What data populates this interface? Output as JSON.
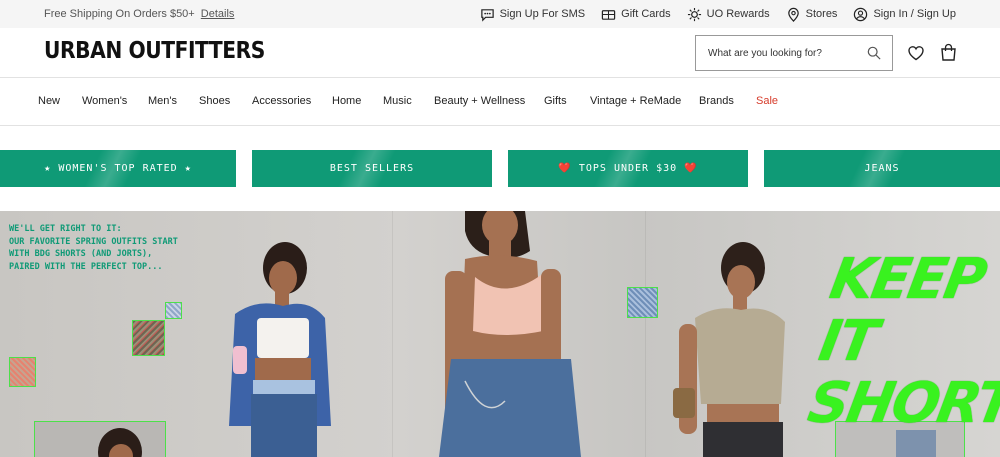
{
  "utility_bar": {
    "promo_text": "Free Shipping On Orders $50+",
    "promo_link": "Details",
    "links": [
      {
        "label": "Sign Up For SMS",
        "icon": "chat-icon"
      },
      {
        "label": "Gift Cards",
        "icon": "gift-card-icon"
      },
      {
        "label": "UO Rewards",
        "icon": "rewards-icon"
      },
      {
        "label": "Stores",
        "icon": "location-pin-icon"
      },
      {
        "label": "Sign In / Sign Up",
        "icon": "user-icon"
      }
    ]
  },
  "header": {
    "logo": "URBAN OUTFITTERS",
    "search_placeholder": "What are you looking for?"
  },
  "nav": {
    "items": [
      "New",
      "Women's",
      "Men's",
      "Shoes",
      "Accessories",
      "Home",
      "Music",
      "Beauty + Wellness",
      "Gifts",
      "Vintage + ReMade",
      "Brands",
      "Sale"
    ]
  },
  "categories": [
    "★ WOMEN'S TOP RATED ★",
    "BEST SELLERS",
    "❤️ TOPS UNDER $30 ❤️",
    "JEANS"
  ],
  "hero": {
    "copy": "WE'LL GET RIGHT TO IT:\nOUR FAVORITE SPRING OUTFITS START\nWITH BDG SHORTS (AND JORTS),\nPAIRED WITH THE PERFECT TOP...",
    "headline": "KEEP IT SHORT"
  },
  "colors": {
    "brand_green": "#0f9a76",
    "sale_red": "#d63b2a",
    "neon_green": "#39f21f"
  }
}
